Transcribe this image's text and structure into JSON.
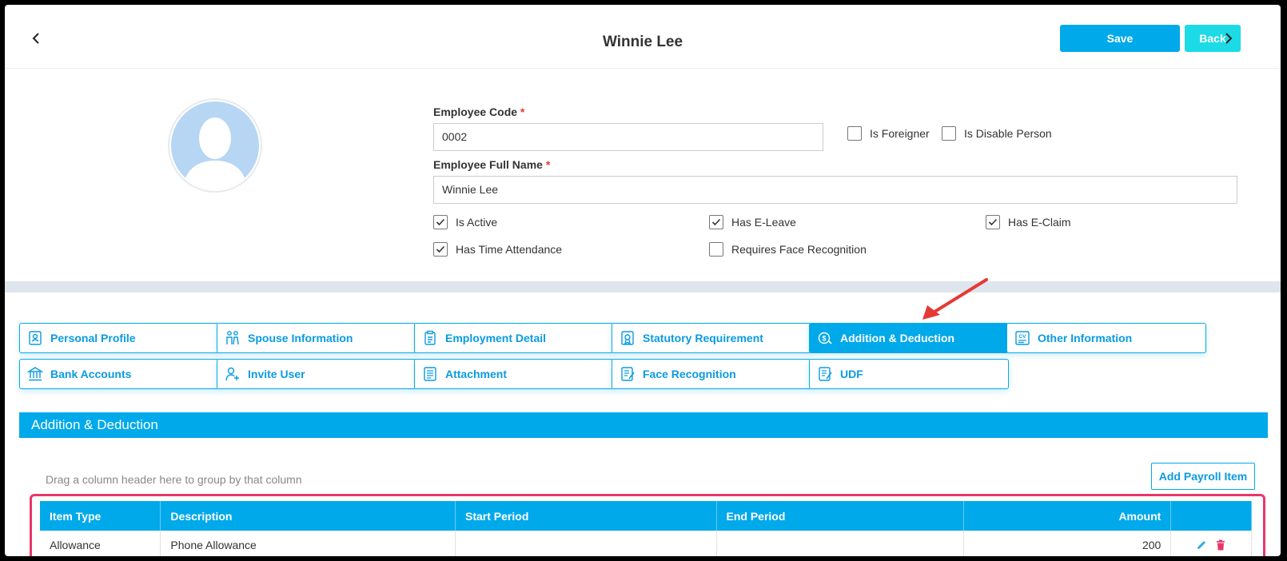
{
  "header": {
    "title": "Winnie Lee",
    "save_label": "Save",
    "back_label": "Back"
  },
  "employee": {
    "code_label": "Employee Code",
    "code_value": "0002",
    "fullname_label": "Employee Full Name",
    "fullname_value": "Winnie Lee",
    "required_mark": "*",
    "checkboxes": [
      {
        "label": "Is Foreigner",
        "checked": false
      },
      {
        "label": "Is Disable Person",
        "checked": false
      },
      {
        "label": "Is Active",
        "checked": true
      },
      {
        "label": "Has E-Leave",
        "checked": true
      },
      {
        "label": "Has E-Claim",
        "checked": true
      },
      {
        "label": "Has Time Attendance",
        "checked": true
      },
      {
        "label": "Requires Face Recognition",
        "checked": false
      }
    ]
  },
  "tabs": [
    {
      "label": "Personal Profile",
      "icon": "profile-icon",
      "active": false
    },
    {
      "label": "Spouse Information",
      "icon": "couple-icon",
      "active": false
    },
    {
      "label": "Employment Detail",
      "icon": "clipboard-icon",
      "active": false
    },
    {
      "label": "Statutory Requirement",
      "icon": "certificate-icon",
      "active": false
    },
    {
      "label": "Addition & Deduction",
      "icon": "money-icon",
      "active": true
    },
    {
      "label": "Other Information",
      "icon": "cv-icon",
      "active": false
    },
    {
      "label": "Bank Accounts",
      "icon": "bank-icon",
      "active": false
    },
    {
      "label": "Invite User",
      "icon": "add-user-icon",
      "active": false
    },
    {
      "label": "Attachment",
      "icon": "document-icon",
      "active": false
    },
    {
      "label": "Face Recognition",
      "icon": "document-edit-icon",
      "active": false
    },
    {
      "label": "UDF",
      "icon": "document-edit-icon",
      "active": false
    }
  ],
  "section": {
    "title": "Addition & Deduction",
    "drag_hint": "Drag a column header here to group by that column",
    "add_button": "Add Payroll Item"
  },
  "grid": {
    "columns": [
      "Item Type",
      "Description",
      "Start Period",
      "End Period",
      "Amount"
    ],
    "rows": [
      {
        "item_type": "Allowance",
        "description": "Phone Allowance",
        "start_period": "",
        "end_period": "",
        "amount": "200"
      }
    ]
  },
  "colors": {
    "primary": "#00a9ea",
    "secondary": "#1cdbe6",
    "highlight": "#e8366a",
    "annotation_arrow": "#e53935"
  }
}
